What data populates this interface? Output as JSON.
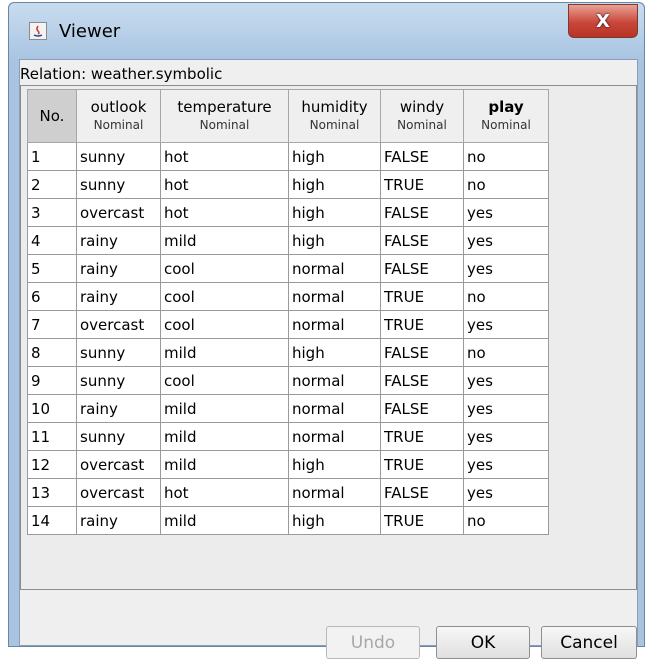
{
  "window": {
    "title": "Viewer",
    "close_label": "X"
  },
  "relation_label": "Relation: weather.symbolic",
  "columns": [
    {
      "name": "No.",
      "type": ""
    },
    {
      "name": "outlook",
      "type": "Nominal"
    },
    {
      "name": "temperature",
      "type": "Nominal"
    },
    {
      "name": "humidity",
      "type": "Nominal"
    },
    {
      "name": "windy",
      "type": "Nominal"
    },
    {
      "name": "play",
      "type": "Nominal"
    }
  ],
  "rows": [
    [
      "1",
      "sunny",
      "hot",
      "high",
      "FALSE",
      "no"
    ],
    [
      "2",
      "sunny",
      "hot",
      "high",
      "TRUE",
      "no"
    ],
    [
      "3",
      "overcast",
      "hot",
      "high",
      "FALSE",
      "yes"
    ],
    [
      "4",
      "rainy",
      "mild",
      "high",
      "FALSE",
      "yes"
    ],
    [
      "5",
      "rainy",
      "cool",
      "normal",
      "FALSE",
      "yes"
    ],
    [
      "6",
      "rainy",
      "cool",
      "normal",
      "TRUE",
      "no"
    ],
    [
      "7",
      "overcast",
      "cool",
      "normal",
      "TRUE",
      "yes"
    ],
    [
      "8",
      "sunny",
      "mild",
      "high",
      "FALSE",
      "no"
    ],
    [
      "9",
      "sunny",
      "cool",
      "normal",
      "FALSE",
      "yes"
    ],
    [
      "10",
      "rainy",
      "mild",
      "normal",
      "FALSE",
      "yes"
    ],
    [
      "11",
      "sunny",
      "mild",
      "normal",
      "TRUE",
      "yes"
    ],
    [
      "12",
      "overcast",
      "mild",
      "high",
      "TRUE",
      "yes"
    ],
    [
      "13",
      "overcast",
      "hot",
      "normal",
      "FALSE",
      "yes"
    ],
    [
      "14",
      "rainy",
      "mild",
      "high",
      "TRUE",
      "no"
    ]
  ],
  "buttons": {
    "undo": "Undo",
    "ok": "OK",
    "cancel": "Cancel"
  },
  "colors": {
    "titlebar": "#a9c5e2",
    "close": "#c8473a",
    "header_no_col": "#cfcfcf"
  }
}
